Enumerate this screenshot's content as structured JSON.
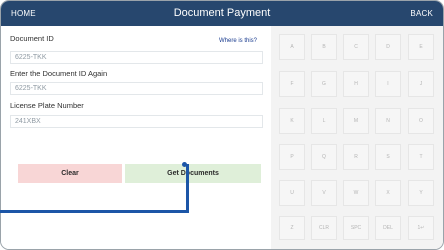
{
  "header": {
    "home": "HOME",
    "title": "Document Payment",
    "back": "BACK"
  },
  "form": {
    "document_id_label": "Document ID",
    "where_link": "Where is this?",
    "document_id_value": "6225-TKK",
    "confirm_label": "Enter the Document ID Again",
    "confirm_value": "6225-TKK",
    "plate_label": "License Plate Number",
    "plate_value": "241XBX",
    "clear_button": "Clear",
    "get_button": "Get Documents"
  },
  "keypad": {
    "keys": [
      [
        "A",
        "B",
        "C",
        "D",
        "E"
      ],
      [
        "F",
        "G",
        "H",
        "I",
        "J"
      ],
      [
        "K",
        "L",
        "M",
        "N",
        "O"
      ],
      [
        "P",
        "Q",
        "R",
        "S",
        "T"
      ],
      [
        "U",
        "V",
        "W",
        "X",
        "Y"
      ],
      [
        "Z",
        "CLR",
        "SPC",
        "DEL",
        "1↵"
      ]
    ]
  },
  "colors": {
    "header_bg": "#27476e",
    "clear_bg": "#f8d6d6",
    "get_bg": "#dfefd9",
    "callout": "#1c56a7"
  }
}
